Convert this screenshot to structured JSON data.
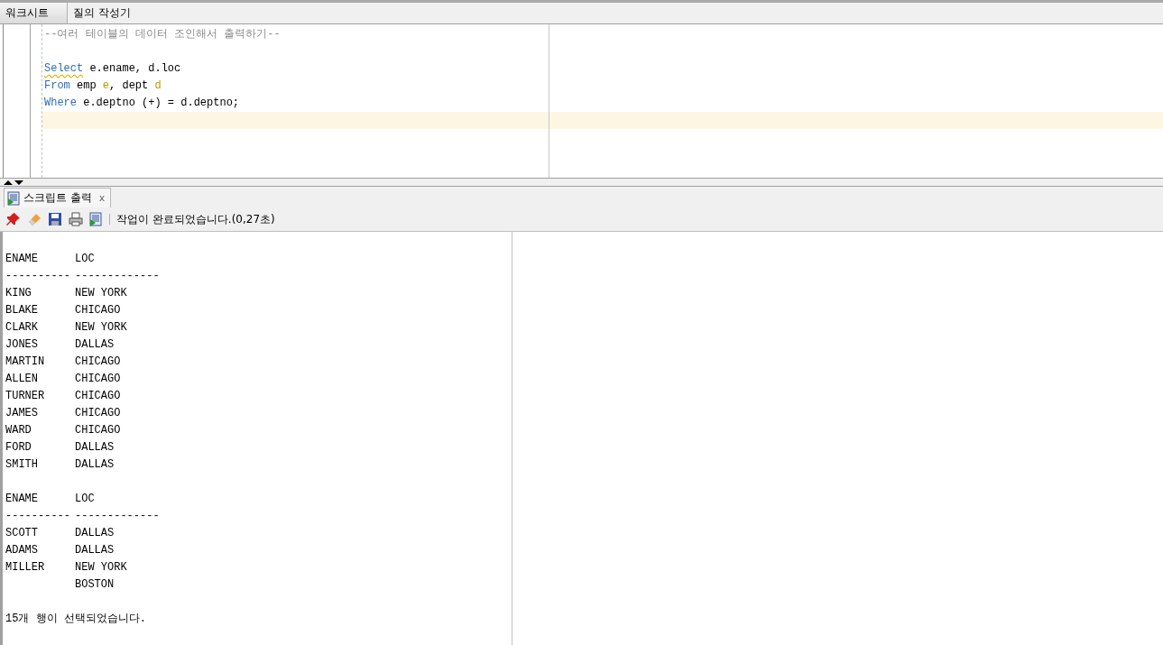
{
  "tabs": [
    {
      "label": "워크시트",
      "selected": true
    },
    {
      "label": "질의 작성기",
      "selected": false
    }
  ],
  "editor": {
    "lines": [
      {
        "kind": "code",
        "current": false,
        "tokens": [
          {
            "kind": "comment",
            "text": "--여러 테이블의 데이터 조인해서 출력하기--",
            "squiggle": false
          }
        ]
      },
      {
        "kind": "blank",
        "current": false
      },
      {
        "kind": "code",
        "current": false,
        "tokens": [
          {
            "kind": "keyword",
            "text": "Select",
            "squiggle": true
          },
          {
            "kind": "plain",
            "text": " e.ename, d.loc",
            "squiggle": false
          }
        ]
      },
      {
        "kind": "code",
        "current": false,
        "tokens": [
          {
            "kind": "keyword",
            "text": "From",
            "squiggle": false
          },
          {
            "kind": "plain",
            "text": " emp ",
            "squiggle": false
          },
          {
            "kind": "alias",
            "text": "e",
            "squiggle": false
          },
          {
            "kind": "plain",
            "text": ", dept ",
            "squiggle": false
          },
          {
            "kind": "alias",
            "text": "d",
            "squiggle": false
          }
        ]
      },
      {
        "kind": "code",
        "current": false,
        "tokens": [
          {
            "kind": "keyword",
            "text": "Where",
            "squiggle": false
          },
          {
            "kind": "plain",
            "text": " e.deptno (+) = d.deptno;",
            "squiggle": false
          }
        ]
      },
      {
        "kind": "blank",
        "current": true
      }
    ]
  },
  "output": {
    "tab": {
      "label": "스크립트 출력",
      "close": "x"
    },
    "status": "작업이 완료되었습니다.(0,27초)",
    "blocks": [
      {
        "columns": [
          "ENAME",
          "LOC"
        ],
        "rules": [
          "----------",
          "-------------"
        ],
        "rows": [
          {
            "cell_1": "KING",
            "cell_2": "NEW YORK"
          },
          {
            "cell_1": "BLAKE",
            "cell_2": "CHICAGO"
          },
          {
            "cell_1": "CLARK",
            "cell_2": "NEW YORK"
          },
          {
            "cell_1": "JONES",
            "cell_2": "DALLAS"
          },
          {
            "cell_1": "MARTIN",
            "cell_2": "CHICAGO"
          },
          {
            "cell_1": "ALLEN",
            "cell_2": "CHICAGO"
          },
          {
            "cell_1": "TURNER",
            "cell_2": "CHICAGO"
          },
          {
            "cell_1": "JAMES",
            "cell_2": "CHICAGO"
          },
          {
            "cell_1": "WARD",
            "cell_2": "CHICAGO"
          },
          {
            "cell_1": "FORD",
            "cell_2": "DALLAS"
          },
          {
            "cell_1": "SMITH",
            "cell_2": "DALLAS"
          }
        ]
      },
      {
        "columns": [
          "ENAME",
          "LOC"
        ],
        "rules": [
          "----------",
          "-------------"
        ],
        "rows": [
          {
            "cell_1": "SCOTT",
            "cell_2": "DALLAS"
          },
          {
            "cell_1": "ADAMS",
            "cell_2": "DALLAS"
          },
          {
            "cell_1": "MILLER",
            "cell_2": "NEW YORK"
          },
          {
            "cell_2": "BOSTON"
          }
        ]
      }
    ],
    "footer": "15개 행이 선택되었습니다."
  }
}
